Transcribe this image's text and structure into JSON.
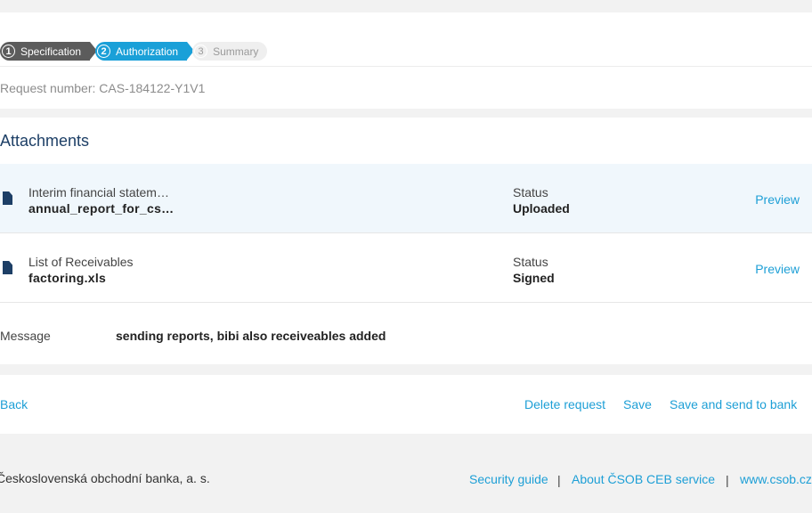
{
  "steps": [
    {
      "num": "1",
      "label": "Specification"
    },
    {
      "num": "2",
      "label": "Authorization"
    },
    {
      "num": "3",
      "label": "Summary"
    }
  ],
  "request_number": "Request number: CAS-184122-Y1V1",
  "attachments": {
    "title": "Attachments",
    "items": [
      {
        "name": "Interim financial statem…",
        "file": "annual_report_for_cs…",
        "status_label": "Status",
        "status": "Uploaded",
        "preview": "Preview"
      },
      {
        "name": "List of Receivables",
        "file": "factoring.xls",
        "status_label": "Status",
        "status": "Signed",
        "preview": "Preview"
      }
    ],
    "message_label": "Message",
    "message": "sending reports, bibi also receiveables added"
  },
  "actions": {
    "back": "Back",
    "delete": "Delete request",
    "save": "Save",
    "save_send": "Save and send to bank"
  },
  "footer": {
    "company": "Československá obchodní banka, a. s.",
    "links": [
      "Security guide",
      "About ČSOB CEB service",
      "www.csob.cz"
    ],
    "separator": "|"
  },
  "colors": {
    "accent": "#1aa0d8",
    "dark_step": "#5c5c5c",
    "title": "#1d3f66",
    "link": "#1d9fd6"
  },
  "icons": {
    "attachment": "document-icon"
  }
}
